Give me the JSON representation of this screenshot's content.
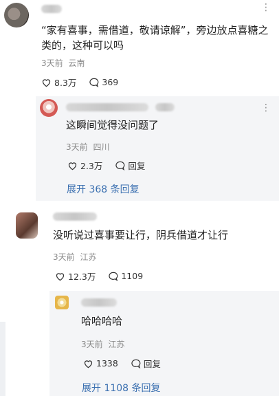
{
  "comments": [
    {
      "avatar_colors": [
        "#6c6660",
        "#9a8f88",
        "#2f2a27"
      ],
      "text": "“家有喜事，需借道，敬请谅解”，旁边放点喜糖之类的，这种可以吗",
      "time": "3天前",
      "location": "云南",
      "likes": "8.3万",
      "replies_count": "369",
      "icon": "more-icon"
    },
    {
      "avatar_colors": [
        "#d45a55",
        "#f0c6c0",
        "#ffffff"
      ],
      "text": "这瞬间觉得没问题了",
      "time": "3天前",
      "location": "四川",
      "likes": "2.3万",
      "reply_label": "回复",
      "icon": "more-icon"
    },
    {
      "expand_label": "展开 368 条回复"
    },
    {
      "avatar_colors": [
        "#5a3a2f",
        "#b07a6a",
        "#d8c3b8"
      ],
      "text": "没听说过喜事要让行，阴兵借道才让行",
      "time": "3天前",
      "location": "江苏",
      "likes": "12.3万",
      "replies_count": "1109"
    },
    {
      "avatar_colors": [
        "#e6b64a",
        "#f2dc98",
        "#ffffff"
      ],
      "text": "哈哈哈哈",
      "time": "3天前",
      "location": "江苏",
      "likes": "1338",
      "reply_label": "回复"
    },
    {
      "expand_label": "展开 1108 条回复"
    }
  ]
}
